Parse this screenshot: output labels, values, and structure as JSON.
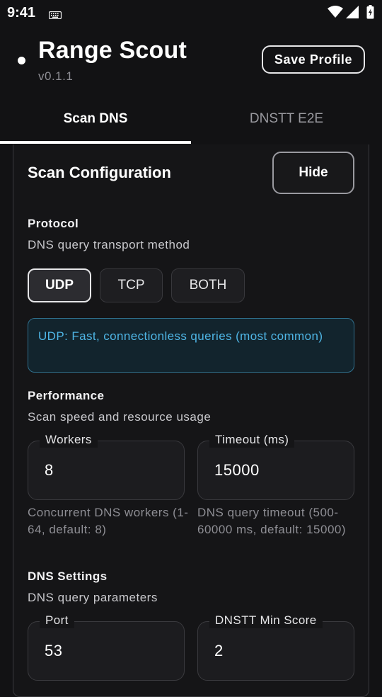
{
  "status_bar": {
    "time": "9:41",
    "icons": [
      "keyboard-icon",
      "wifi-icon",
      "signal-icon",
      "battery-icon"
    ]
  },
  "header": {
    "title": "Range Scout",
    "version": "v0.1.1",
    "save_label": "Save Profile"
  },
  "tabs": [
    {
      "label": "Scan DNS",
      "selected": true
    },
    {
      "label": "DNSTT E2E",
      "selected": false
    }
  ],
  "card": {
    "title": "Scan Configuration",
    "hide_label": "Hide",
    "protocol": {
      "title": "Protocol",
      "subtitle": "DNS query transport method",
      "options": [
        "UDP",
        "TCP",
        "BOTH"
      ],
      "selected": "UDP",
      "info": "UDP: Fast, connectionless queries (most common)"
    },
    "performance": {
      "title": "Performance",
      "subtitle": "Scan speed and resource usage",
      "workers": {
        "label": "Workers",
        "value": "8",
        "helper": "Concurrent DNS workers (1-64, default: 8)"
      },
      "timeout": {
        "label": "Timeout (ms)",
        "value": "15000",
        "helper": "DNS query timeout (500-60000 ms, default: 15000)"
      }
    },
    "dns_settings": {
      "title": "DNS Settings",
      "subtitle": "DNS query parameters",
      "port": {
        "label": "Port",
        "value": "53"
      },
      "min_score": {
        "label": "DNSTT Min Score",
        "value": "2"
      }
    }
  },
  "colors": {
    "background": "#121214",
    "accent_info": "#4fb6e6",
    "info_border": "#2f6f8c"
  }
}
